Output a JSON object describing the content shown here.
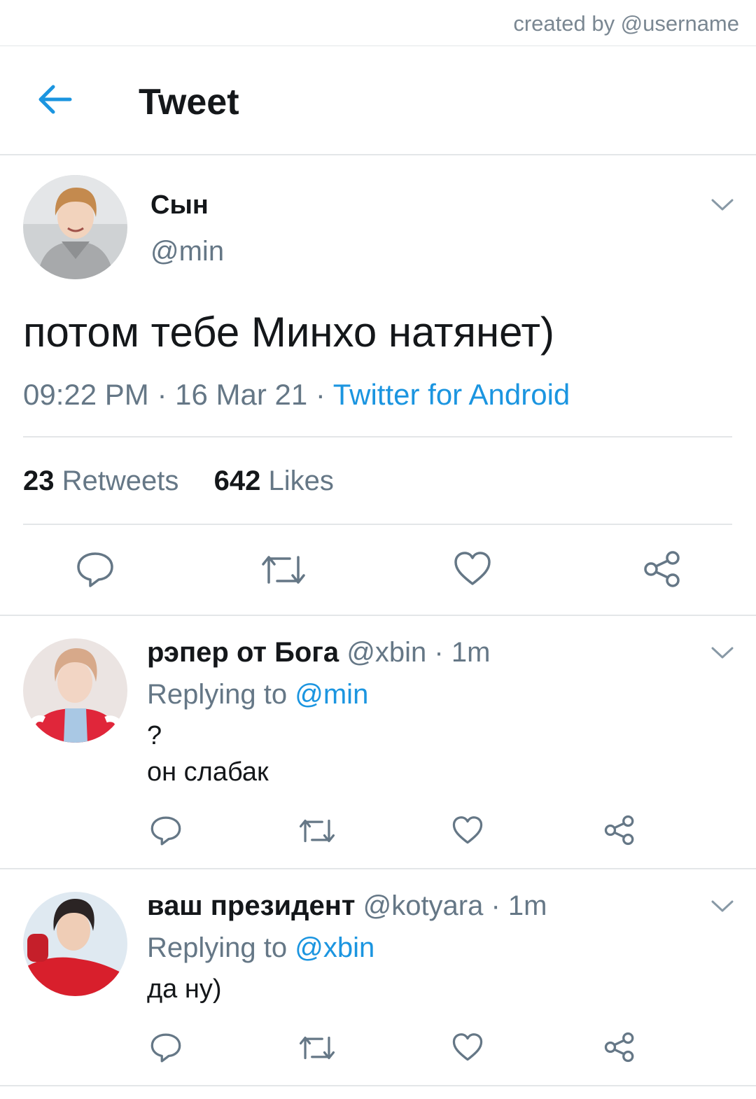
{
  "credit": "created by @username",
  "header": {
    "title": "Tweet"
  },
  "main_tweet": {
    "name": "Сын",
    "handle": "@min",
    "text": "потом тебе Минхо натянет)",
    "time": "09:22 PM",
    "date": "16 Mar 21",
    "separator": " · ",
    "source": "Twitter for Android",
    "retweets_count": "23",
    "retweets_label": "Retweets",
    "likes_count": "642",
    "likes_label": "Likes"
  },
  "replies": [
    {
      "name": "рэпер от Бога",
      "handle": "@xbin",
      "time": "· 1m",
      "replying_label": "Replying to",
      "replying_to": "@min",
      "line1": "?",
      "line2": "он слабак"
    },
    {
      "name": "ваш президент",
      "handle": "@kotyara",
      "time": "· 1m",
      "replying_label": "Replying to",
      "replying_to": "@xbin",
      "line1": "да ну)"
    }
  ],
  "colors": {
    "accent": "#1b95e0",
    "secondary_text": "#657786",
    "icon": "#657786",
    "divider": "#e3e6e8"
  },
  "icons": [
    "arrow-left-icon",
    "chevron-down-icon",
    "reply-icon",
    "retweet-icon",
    "heart-icon",
    "share-icon"
  ]
}
